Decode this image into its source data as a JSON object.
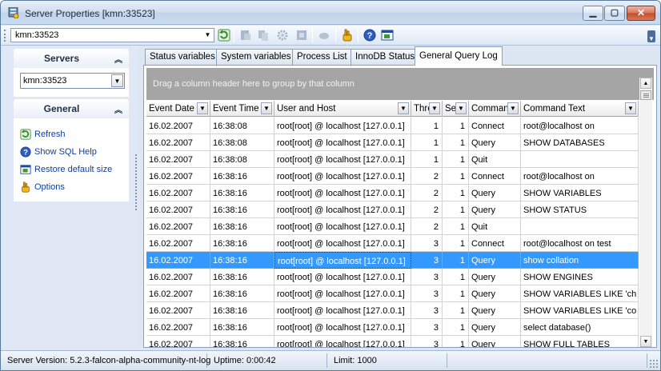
{
  "window": {
    "title": "Server Properties [kmn:33523]"
  },
  "toolbar": {
    "server_value": "kmn:33523",
    "icons": [
      "refresh-icon",
      "server-icon",
      "copy-icon",
      "gear-icon",
      "register-icon",
      "unregister-icon",
      "options-icon",
      "help-icon",
      "restore-size-icon"
    ]
  },
  "sidebar": {
    "servers_header": "Servers",
    "server_value": "kmn:33523",
    "general_header": "General",
    "actions": [
      {
        "label": "Refresh",
        "icon": "refresh-icon"
      },
      {
        "label": "Show SQL Help",
        "icon": "help-icon"
      },
      {
        "label": "Restore default size",
        "icon": "restore-size-icon"
      },
      {
        "label": "Options",
        "icon": "options-icon"
      }
    ]
  },
  "tabs": [
    {
      "label": "Status variables",
      "active": false
    },
    {
      "label": "System variables",
      "active": false
    },
    {
      "label": "Process List",
      "active": false
    },
    {
      "label": "InnoDB Status",
      "active": false
    },
    {
      "label": "General Query Log",
      "active": true
    }
  ],
  "grid": {
    "group_hint": "Drag a column header here to group by that column",
    "columns": [
      "Event Date",
      "Event Time",
      "User and Host",
      "Thre",
      "Se",
      "Comman",
      "Command Text"
    ],
    "selected_row": 8,
    "rows": [
      [
        "16.02.2007",
        "16:38:08",
        "root[root] @ localhost [127.0.0.1]",
        "1",
        "1",
        "Connect",
        "root@localhost on"
      ],
      [
        "16.02.2007",
        "16:38:08",
        "root[root] @ localhost [127.0.0.1]",
        "1",
        "1",
        "Query",
        "SHOW DATABASES"
      ],
      [
        "16.02.2007",
        "16:38:08",
        "root[root] @ localhost [127.0.0.1]",
        "1",
        "1",
        "Quit",
        ""
      ],
      [
        "16.02.2007",
        "16:38:16",
        "root[root] @ localhost [127.0.0.1]",
        "2",
        "1",
        "Connect",
        "root@localhost on"
      ],
      [
        "16.02.2007",
        "16:38:16",
        "root[root] @ localhost [127.0.0.1]",
        "2",
        "1",
        "Query",
        "SHOW VARIABLES"
      ],
      [
        "16.02.2007",
        "16:38:16",
        "root[root] @ localhost [127.0.0.1]",
        "2",
        "1",
        "Query",
        "SHOW STATUS"
      ],
      [
        "16.02.2007",
        "16:38:16",
        "root[root] @ localhost [127.0.0.1]",
        "2",
        "1",
        "Quit",
        ""
      ],
      [
        "16.02.2007",
        "16:38:16",
        "root[root] @ localhost [127.0.0.1]",
        "3",
        "1",
        "Connect",
        "root@localhost on test"
      ],
      [
        "16.02.2007",
        "16:38:16",
        "root[root] @ localhost [127.0.0.1]",
        "3",
        "1",
        "Query",
        "show collation"
      ],
      [
        "16.02.2007",
        "16:38:16",
        "root[root] @ localhost [127.0.0.1]",
        "3",
        "1",
        "Query",
        "SHOW ENGINES"
      ],
      [
        "16.02.2007",
        "16:38:16",
        "root[root] @ localhost [127.0.0.1]",
        "3",
        "1",
        "Query",
        "SHOW VARIABLES LIKE 'ch"
      ],
      [
        "16.02.2007",
        "16:38:16",
        "root[root] @ localhost [127.0.0.1]",
        "3",
        "1",
        "Query",
        "SHOW VARIABLES LIKE 'co"
      ],
      [
        "16.02.2007",
        "16:38:16",
        "root[root] @ localhost [127.0.0.1]",
        "3",
        "1",
        "Query",
        "select database()"
      ],
      [
        "16.02.2007",
        "16:38:16",
        "root[root] @ localhost [127.0.0.1]",
        "3",
        "1",
        "Query",
        "SHOW FULL TABLES"
      ]
    ]
  },
  "statusbar": {
    "version": "Server Version: 5.2.3-falcon-alpha-community-nt-log",
    "uptime": "Uptime: 0:00:42",
    "limit": "Limit: 1000"
  },
  "colors": {
    "selection": "#3399ff",
    "link": "#0c3ea6",
    "group_area": "#a5a5a5"
  }
}
